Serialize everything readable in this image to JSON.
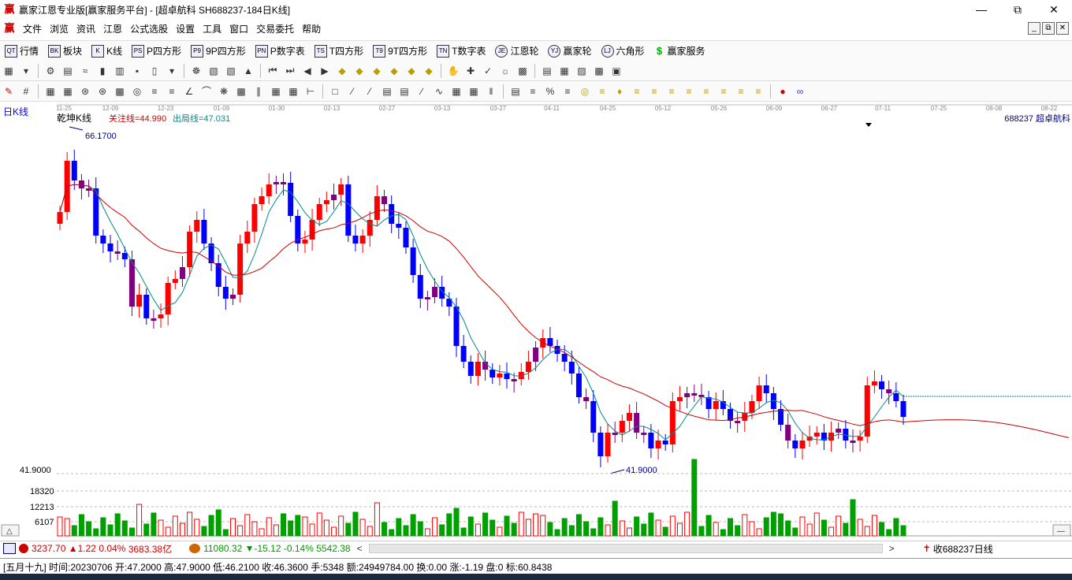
{
  "window": {
    "app_title": "赢家江恩专业版[赢家服务平台] - [超卓航科   SH688237-184日K线]"
  },
  "menu": [
    "文件",
    "浏览",
    "资讯",
    "江恩",
    "公式选股",
    "设置",
    "工具",
    "窗口",
    "交易委托",
    "帮助"
  ],
  "toolbar1": [
    "行情",
    "板块",
    "K线",
    "P四方形",
    "9P四方形",
    "P数字表",
    "T四方形",
    "9T四方形",
    "T数字表",
    "江恩轮",
    "赢家轮",
    "六角形",
    "赢家服务"
  ],
  "toolbar1_icons": [
    "QT",
    "BK",
    "K",
    "PS",
    "P9",
    "PN",
    "TS",
    "T9",
    "TN",
    "JE",
    "YJ",
    "LJ",
    "$"
  ],
  "chart": {
    "period_label": "日K线",
    "indicator_name": "乾坤K线",
    "attention_label": "关注线=44.990",
    "exit_label": "出局线=47.031",
    "code_name": "688237  超卓航科",
    "dates": [
      "11-25",
      "12-09",
      "12-23",
      "01-09",
      "01-30",
      "02-13",
      "02-27",
      "03-13",
      "03-27",
      "04-11",
      "04-25",
      "05-12",
      "05-26",
      "06-09",
      "06-27",
      "07-11",
      "07-25",
      "08-08",
      "08-22"
    ],
    "high_marker": "66.1700",
    "low_marker": "41.9000",
    "price_label_low": "41.9000",
    "volume_labels": [
      "18320",
      "12213",
      "6107"
    ],
    "colors": {
      "up": "#ff0000",
      "down": "#0000ff",
      "mixed": "#800080",
      "ma_short": "#008b8b",
      "ma_long": "#cc0000",
      "volume": "#00a000"
    }
  },
  "index_bar": {
    "sh_value": "3237.70",
    "sh_change": "▲1.22",
    "sh_pct": "0.04%",
    "sh_amount": "3683.38亿",
    "sz_value": "11080.32",
    "sz_change": "▼-15.12",
    "sz_pct": "-0.14%",
    "sz_amount": "5542.38",
    "fav_label": "收688237日线"
  },
  "status": "[五月十九] 时间:20230706 开:47.2000 高:47.9000 低:46.2100 收:46.3600 手:5348 额:24949784.00 换:0.00 涨:-1.19 盘:0 标:60.8438"
}
